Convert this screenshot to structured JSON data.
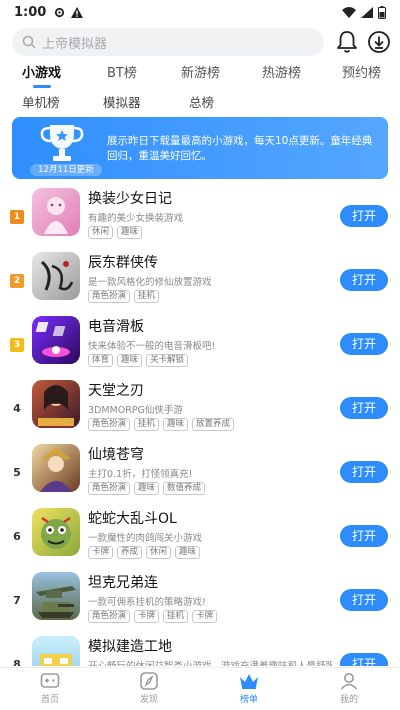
{
  "status_bar": {
    "time": "1:00"
  },
  "search": {
    "placeholder": "上帝模拟器"
  },
  "tabs": [
    {
      "label": "小游戏",
      "active": true
    },
    {
      "label": "BT榜"
    },
    {
      "label": "新游榜"
    },
    {
      "label": "热游榜"
    },
    {
      "label": "预约榜"
    }
  ],
  "subtabs": [
    {
      "label": "单机榜"
    },
    {
      "label": "模拟器"
    },
    {
      "label": "总榜"
    }
  ],
  "banner": {
    "text": "展示昨日下载量最高的小游戏，每天10点更新。童年经典回归，重温美好回忆。",
    "date": "12月11日更新"
  },
  "apps": [
    {
      "rank": "1",
      "name": "换装少女日记",
      "desc": "有趣的美少女换装游戏",
      "tags": [
        "休闲",
        "趣味"
      ],
      "button": "打开",
      "icon_colors": [
        "#f5c0dd",
        "#e07fb8"
      ]
    },
    {
      "rank": "2",
      "name": "辰东群侠传",
      "desc": "是一款风格化的修仙放置游戏",
      "tags": [
        "角色扮演",
        "挂机"
      ],
      "button": "打开",
      "icon_colors": [
        "#d9d9d9",
        "#333333"
      ]
    },
    {
      "rank": "3",
      "name": "电音滑板",
      "desc": "快来体验不一般的电音滑板吧!",
      "tags": [
        "体育",
        "趣味",
        "关卡解锁"
      ],
      "button": "打开",
      "icon_colors": [
        "#7b2dff",
        "#2b0a5c"
      ]
    },
    {
      "rank": "4",
      "name": "天堂之刃",
      "desc": "3DMMORPG仙侠手游",
      "tags": [
        "角色扮演",
        "挂机",
        "趣味",
        "放置养成"
      ],
      "button": "打开",
      "icon_colors": [
        "#c25a3a",
        "#3a1a2a"
      ]
    },
    {
      "rank": "5",
      "name": "仙境苍穹",
      "desc": "主打0.1折，打怪领真充!",
      "tags": [
        "角色扮演",
        "趣味",
        "数值养成"
      ],
      "button": "打开",
      "icon_colors": [
        "#d8b36a",
        "#6a3a22"
      ]
    },
    {
      "rank": "6",
      "name": "蛇蛇大乱斗OL",
      "desc": "一款魔性的肉鸽闯关小游戏",
      "tags": [
        "卡牌",
        "养成",
        "休闲",
        "趣味"
      ],
      "button": "打开",
      "icon_colors": [
        "#e8d84a",
        "#7a9a3a"
      ]
    },
    {
      "rank": "7",
      "name": "坦克兄弟连",
      "desc": "一款可佣系挂机的策略游戏!",
      "tags": [
        "角色扮演",
        "卡牌",
        "挂机",
        "卡牌"
      ],
      "button": "打开",
      "icon_colors": [
        "#7aa2c8",
        "#4a5a3a"
      ]
    },
    {
      "rank": "8",
      "name": "模拟建造工地",
      "desc": "开心畅玩的休闲益智类小游戏，游戏充满着趣味和人最舒服的",
      "tags": [],
      "button": "打开",
      "icon_colors": [
        "#bfe6f5",
        "#6ac24a"
      ]
    }
  ],
  "bottom_nav": [
    {
      "label": "首页",
      "icon": "gamepad-icon"
    },
    {
      "label": "发现",
      "icon": "compass-icon"
    },
    {
      "label": "榜单",
      "icon": "crown-icon",
      "active": true
    },
    {
      "label": "我的",
      "icon": "user-icon"
    }
  ],
  "colors": {
    "accent": "#2d8cff",
    "banner": "#3b95ff"
  }
}
